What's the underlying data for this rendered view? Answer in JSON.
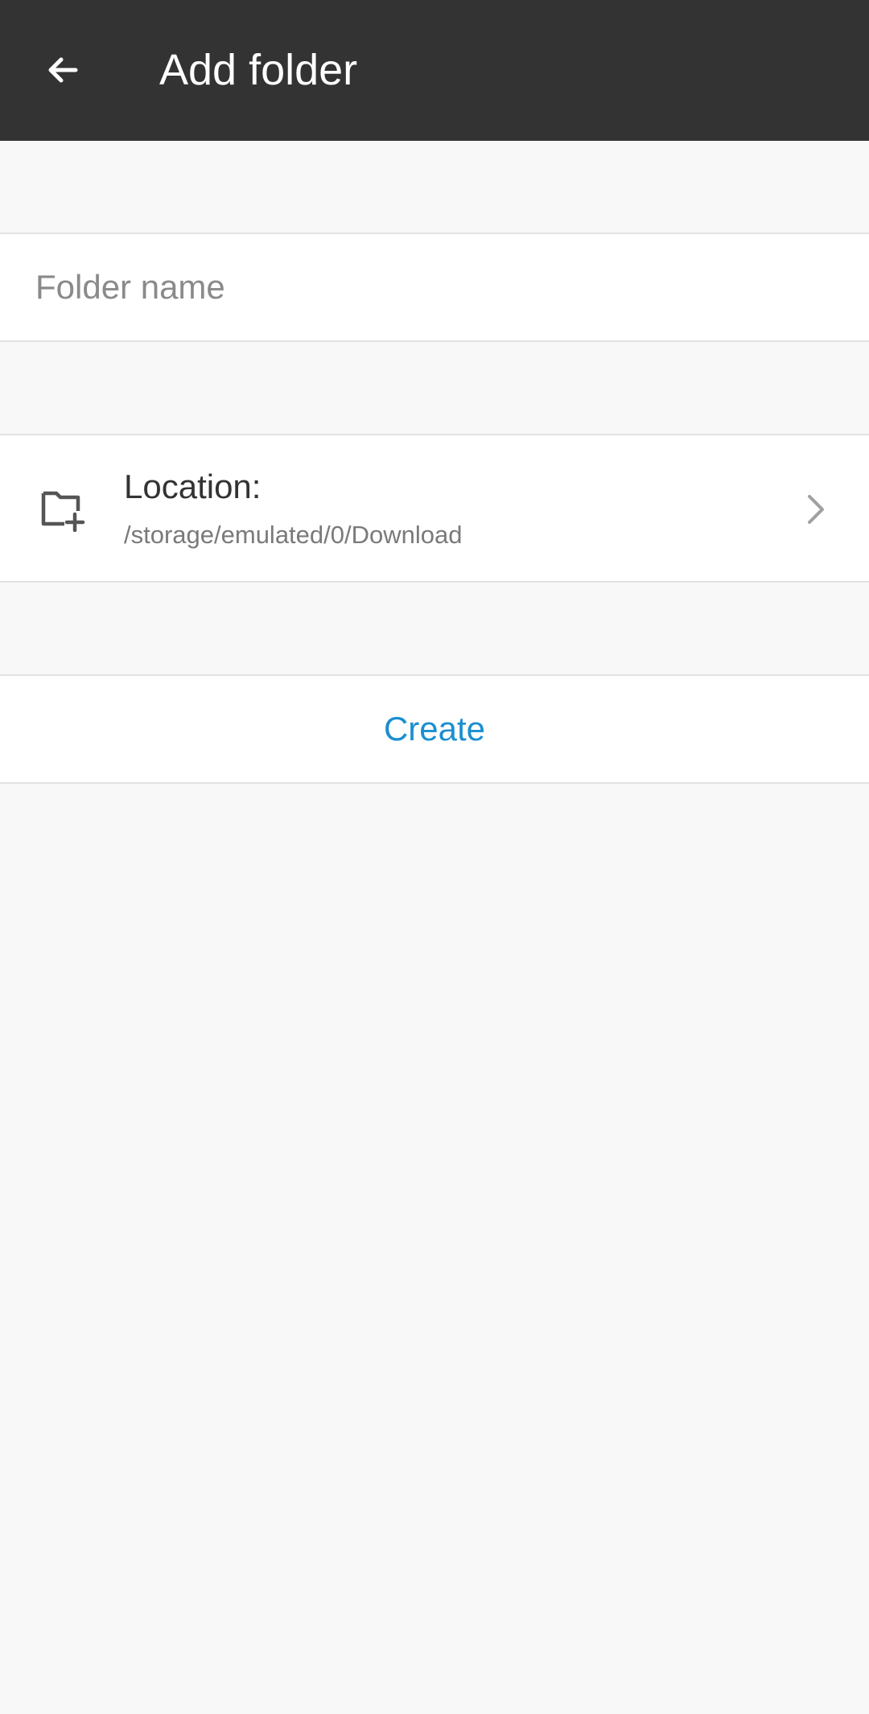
{
  "header": {
    "title": "Add folder",
    "back_icon": "arrow-left-icon",
    "background_color": "#333333"
  },
  "folder_name": {
    "value": "",
    "placeholder": "Folder name"
  },
  "location": {
    "label": "Location:",
    "path": "/storage/emulated/0/Download",
    "icon": "folder-add-icon",
    "chevron_icon": "chevron-right-icon"
  },
  "actions": {
    "create_label": "Create",
    "accent_color": "#1a8fd0"
  }
}
